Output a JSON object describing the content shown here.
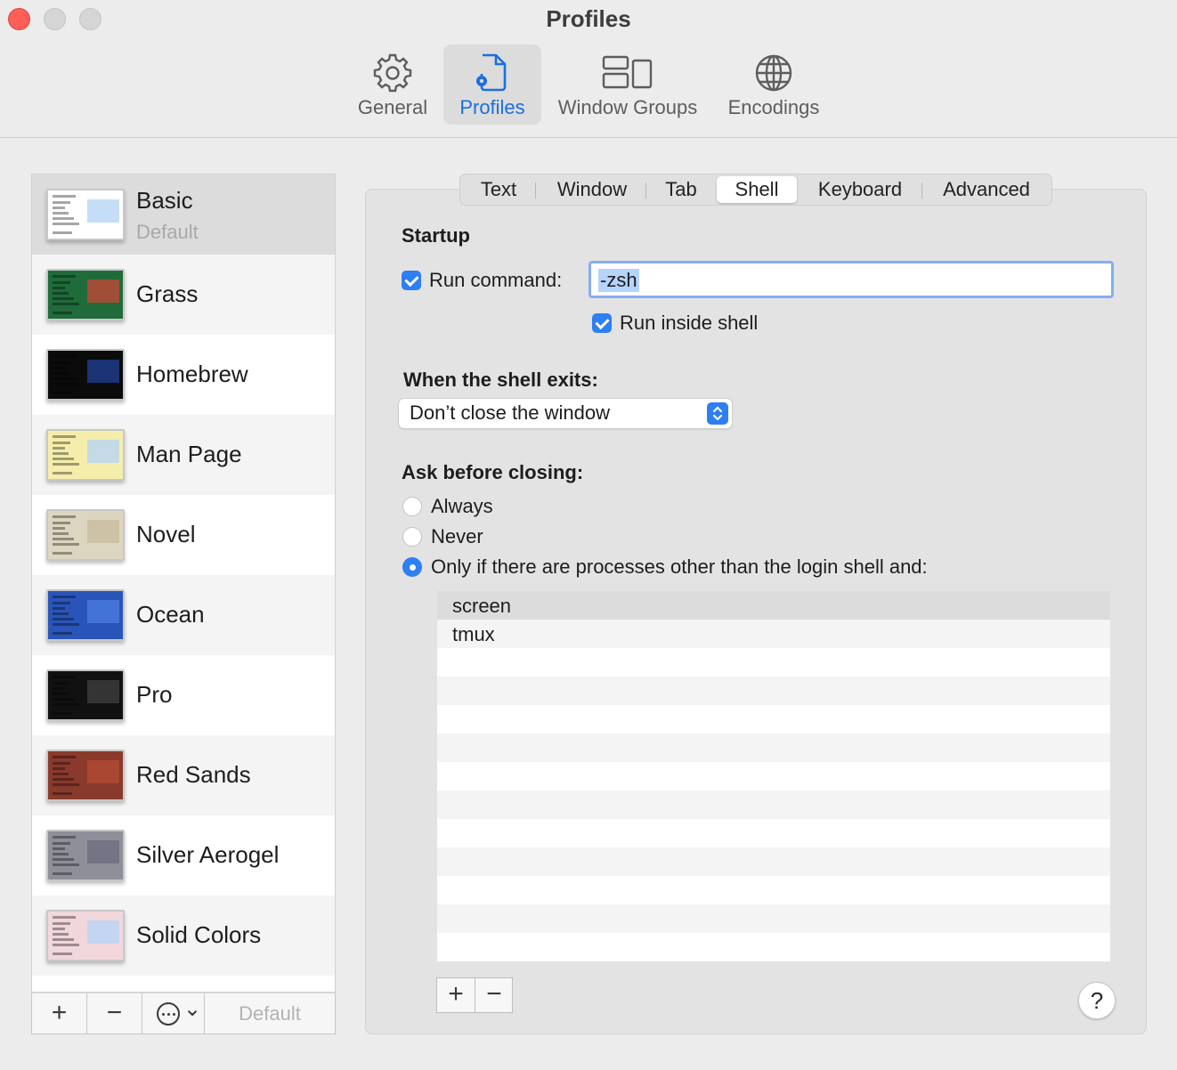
{
  "window": {
    "title": "Profiles"
  },
  "toolbar": {
    "items": [
      {
        "label": "General",
        "icon": "gear-icon"
      },
      {
        "label": "Profiles",
        "icon": "document-gear-icon",
        "selected": true
      },
      {
        "label": "Window Groups",
        "icon": "window-groups-icon"
      },
      {
        "label": "Encodings",
        "icon": "globe-icon"
      }
    ]
  },
  "profiles": [
    {
      "name": "Basic",
      "subtitle": "Default",
      "thumb_bg": "#ffffff",
      "accent": "#b8d4f5",
      "selected": true
    },
    {
      "name": "Grass",
      "subtitle": "",
      "thumb_bg": "#1f6b3a",
      "accent": "#c2473a"
    },
    {
      "name": "Homebrew",
      "subtitle": "",
      "thumb_bg": "#0b0b0b",
      "accent": "#1d3d8e"
    },
    {
      "name": "Man Page",
      "subtitle": "",
      "thumb_bg": "#f5eeab",
      "accent": "#b8d4f5"
    },
    {
      "name": "Novel",
      "subtitle": "",
      "thumb_bg": "#dcd6c0",
      "accent": "#c9bd9f"
    },
    {
      "name": "Ocean",
      "subtitle": "",
      "thumb_bg": "#2a55b8",
      "accent": "#4b7ae0"
    },
    {
      "name": "Pro",
      "subtitle": "",
      "thumb_bg": "#111111",
      "accent": "#3d3d3d"
    },
    {
      "name": "Red Sands",
      "subtitle": "",
      "thumb_bg": "#8a3a2c",
      "accent": "#b04b35"
    },
    {
      "name": "Silver Aerogel",
      "subtitle": "",
      "thumb_bg": "#8f8f99",
      "accent": "#6d6d80"
    },
    {
      "name": "Solid Colors",
      "subtitle": "",
      "thumb_bg": "#f1d7dc",
      "accent": "#b8d4f5"
    }
  ],
  "sidebar_buttons": {
    "add": "+",
    "remove": "−",
    "more_chevron": "⌄",
    "default": "Default"
  },
  "tabs": [
    {
      "label": "Text"
    },
    {
      "label": "Window"
    },
    {
      "label": "Tab"
    },
    {
      "label": "Shell",
      "active": true
    },
    {
      "label": "Keyboard"
    },
    {
      "label": "Advanced"
    }
  ],
  "shell": {
    "startup_heading": "Startup",
    "run_command_label": "Run command:",
    "run_command_checked": true,
    "run_command_value": "-zsh",
    "run_inside_shell_label": "Run inside shell",
    "run_inside_shell_checked": true,
    "exit_heading": "When the shell exits:",
    "exit_value": "Don’t close the window",
    "ask_heading": "Ask before closing:",
    "ask_options": [
      {
        "label": "Always",
        "selected": false
      },
      {
        "label": "Never",
        "selected": false
      },
      {
        "label": "Only if there are processes other than the login shell and:",
        "selected": true
      }
    ],
    "processes": [
      "screen",
      "tmux"
    ],
    "add_label": "+",
    "remove_label": "−",
    "help_label": "?"
  },
  "colors": {
    "accent": "#2e7ff2",
    "close": "#ff5f57",
    "selected_tab_text": "#1a6fe0"
  }
}
